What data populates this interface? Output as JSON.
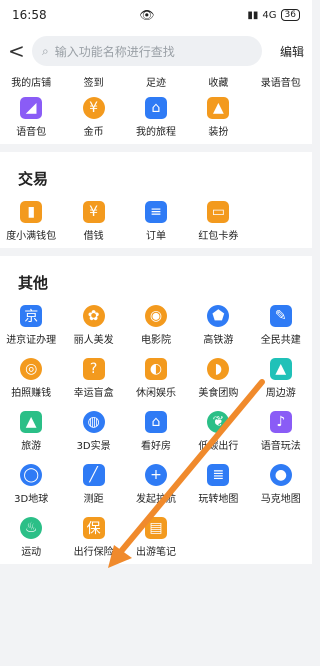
{
  "status": {
    "time": "16:58",
    "network": "4G",
    "battery": "36"
  },
  "search": {
    "placeholder": "输入功能名称进行查找",
    "edit_label": "编辑",
    "back_symbol": "<"
  },
  "top_rows": {
    "labels_row1": [
      "我的店铺",
      "签到",
      "足迹",
      "收藏",
      "录语音包"
    ],
    "items_row2": [
      {
        "label": "语音包",
        "icon": "voice-pack-icon",
        "color": "#8a5cf6"
      },
      {
        "label": "金币",
        "icon": "coin-icon",
        "color": "#f39a1e"
      },
      {
        "label": "我的旅程",
        "icon": "journey-icon",
        "color": "#2f7bf5"
      },
      {
        "label": "装扮",
        "icon": "dressup-icon",
        "color": "#f39a1e"
      }
    ]
  },
  "trade": {
    "title": "交易",
    "items": [
      {
        "label": "度小满钱包",
        "icon": "wallet-icon",
        "color": "#f39a1e"
      },
      {
        "label": "借钱",
        "icon": "yuan-icon",
        "color": "#f39a1e"
      },
      {
        "label": "订单",
        "icon": "order-icon",
        "color": "#2f7bf5"
      },
      {
        "label": "红包卡券",
        "icon": "coupon-icon",
        "color": "#f39a1e"
      }
    ]
  },
  "other": {
    "title": "其他",
    "items": [
      {
        "label": "进京证办理",
        "icon": "jing-icon",
        "color": "#2f7bf5"
      },
      {
        "label": "丽人美发",
        "icon": "beauty-icon",
        "color": "#f39a1e"
      },
      {
        "label": "电影院",
        "icon": "cinema-icon",
        "color": "#f39a1e"
      },
      {
        "label": "高铁游",
        "icon": "train-icon",
        "color": "#2f7bf5"
      },
      {
        "label": "全民共建",
        "icon": "edit-icon",
        "color": "#2f7bf5"
      },
      {
        "label": "拍照赚钱",
        "icon": "camera-money-icon",
        "color": "#f39a1e"
      },
      {
        "label": "幸运盲盒",
        "icon": "blindbox-icon",
        "color": "#f39a1e"
      },
      {
        "label": "休闲娱乐",
        "icon": "game-icon",
        "color": "#f39a1e"
      },
      {
        "label": "美食团购",
        "icon": "food-icon",
        "color": "#f39a1e"
      },
      {
        "label": "周边游",
        "icon": "tour-icon",
        "color": "#20c1b8"
      },
      {
        "label": "旅游",
        "icon": "mountain-icon",
        "color": "#2bbf87"
      },
      {
        "label": "3D实景",
        "icon": "3d-scene-icon",
        "color": "#2f7bf5"
      },
      {
        "label": "看好房",
        "icon": "house-icon",
        "color": "#2f7bf5"
      },
      {
        "label": "低碳出行",
        "icon": "leaf-icon",
        "color": "#2bbf87"
      },
      {
        "label": "语音玩法",
        "icon": "voice-play-icon",
        "color": "#8a5cf6"
      },
      {
        "label": "3D地球",
        "icon": "globe-icon",
        "color": "#2f7bf5"
      },
      {
        "label": "测距",
        "icon": "ruler-icon",
        "color": "#2f7bf5"
      },
      {
        "label": "发起护航",
        "icon": "escort-icon",
        "color": "#2f7bf5"
      },
      {
        "label": "玩转地图",
        "icon": "map-guide-icon",
        "color": "#2f7bf5"
      },
      {
        "label": "马克地图",
        "icon": "pin-icon",
        "color": "#2f7bf5"
      },
      {
        "label": "运动",
        "icon": "flame-icon",
        "color": "#2bbf87"
      },
      {
        "label": "出行保险",
        "icon": "insurance-icon",
        "color": "#f39a1e"
      },
      {
        "label": "出游笔记",
        "icon": "notebook-icon",
        "color": "#f39a1e"
      }
    ]
  }
}
